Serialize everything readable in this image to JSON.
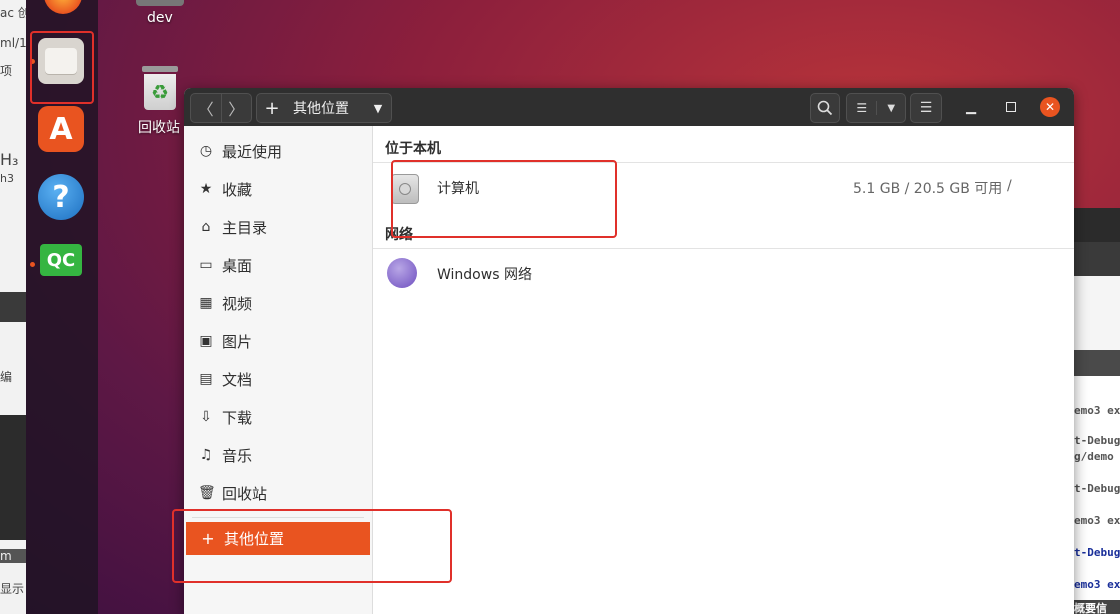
{
  "background_left": {
    "lines": [
      "ac 创",
      "ml/1",
      "项",
      "H₃",
      "h3",
      "编",
      "m",
      "显示"
    ]
  },
  "desktop": {
    "dev_label": "dev",
    "trash_label": "回收站"
  },
  "dock": {
    "qc_label": "QC",
    "help_label": "?"
  },
  "window": {
    "location_label": "其他位置",
    "nav_back": "〈",
    "nav_forward": "〉",
    "plus": "+"
  },
  "sidebar": {
    "items": [
      {
        "label": "最近使用",
        "icon": "clock-icon"
      },
      {
        "label": "收藏",
        "icon": "star-icon"
      },
      {
        "label": "主目录",
        "icon": "home-icon"
      },
      {
        "label": "桌面",
        "icon": "desktop-icon"
      },
      {
        "label": "视频",
        "icon": "video-icon"
      },
      {
        "label": "图片",
        "icon": "picture-icon"
      },
      {
        "label": "文档",
        "icon": "document-icon"
      },
      {
        "label": "下载",
        "icon": "download-icon"
      },
      {
        "label": "音乐",
        "icon": "music-icon"
      },
      {
        "label": "回收站",
        "icon": "trash-icon"
      }
    ],
    "other": {
      "label": "其他位置",
      "icon": "plus-icon"
    }
  },
  "main": {
    "on_this_computer": "位于本机",
    "computer_name": "计算机",
    "computer_usage": "5.1 GB / 20.5 GB 可用",
    "computer_path": "/",
    "network_header": "网络",
    "windows_network": "Windows 网络"
  },
  "terminal": {
    "lines": [
      "emo3 ex",
      "t-Debug",
      "g/demo",
      "t-Debug",
      "emo3 ex",
      "t-Debug",
      "emo3 ex",
      "概要信"
    ]
  },
  "colors": {
    "accent": "#e95420",
    "highlight_box": "#e0302a"
  }
}
